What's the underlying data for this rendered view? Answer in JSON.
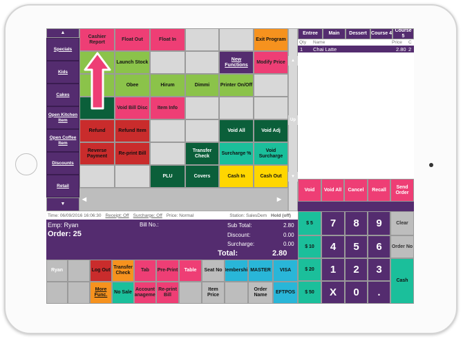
{
  "sidebar": {
    "items": [
      "Specials",
      "Kids",
      "Cakes",
      "Open Kitchen Item",
      "Open Coffee Item",
      "Discounts",
      "Retail"
    ],
    "up_arrow": "▲",
    "down_arrow": "▼"
  },
  "grid": {
    "row1": [
      "Cashier Report",
      "Float Out",
      "Float In",
      "",
      "",
      "Exit Program"
    ],
    "row2": [
      "Launch Stock",
      "",
      "",
      "New Functions",
      "Modify Price"
    ],
    "row3": [
      "Obee",
      "Hirum",
      "Dimmi",
      "Printer On/Off"
    ],
    "row4": [
      "Void Bill Disc",
      "Item Info",
      "",
      "",
      ""
    ],
    "row5": [
      "Refund",
      "Refund Item",
      "",
      "",
      "Void All",
      "Void Adj"
    ],
    "row6": [
      "Reverse Payment",
      "Re-print Bill",
      "",
      "Transfer Check",
      "Surcharge %",
      "Void Surcharge"
    ],
    "row7": [
      "",
      "",
      "PLU",
      "Covers",
      "Cash In",
      "Cash Out"
    ],
    "nav": {
      "left": "◀",
      "right": "▶",
      "up": "▲",
      "up_label": "Up",
      "down": "▼"
    }
  },
  "order_panel": {
    "courses": [
      "Entree",
      "Main",
      "Dessert",
      "Course 4",
      "Course 5"
    ],
    "headers": {
      "qty": "Qty",
      "name": "Name",
      "price": "Price",
      "c": "C"
    },
    "items": [
      {
        "qty": "1",
        "name": "Chai Latte",
        "price": "2.80",
        "c": "2"
      }
    ],
    "actions": [
      "Void",
      "Void All",
      "Cancel",
      "Recall",
      "Send Order"
    ]
  },
  "status_bar": {
    "time": "Time: 06/09/2016 16:06:30",
    "receipt": "Receipt: Off",
    "surcharge": "Surcharge: Off",
    "price": "Price: Normal",
    "station": "Station: SalesDem",
    "hold": "Hold (off)"
  },
  "summary": {
    "emp": "Emp: Ryan",
    "bill_no": "Bill No.:",
    "order": "Order: 25",
    "subtotal_label": "Sub Total:",
    "subtotal": "2.80",
    "discount_label": "Discount:",
    "discount": "0.00",
    "surcharge_label": "Surcharge:",
    "surcharge": "0.00",
    "total_label": "Total:",
    "total": "2.80"
  },
  "keypad": {
    "quick": [
      "$ 5",
      "$ 10",
      "$ 20",
      "$ 50"
    ],
    "keys": [
      "7",
      "8",
      "9",
      "4",
      "5",
      "6",
      "1",
      "2",
      "3",
      "X",
      "0",
      "."
    ],
    "clear": "Clear",
    "order_no": "Order No",
    "cash": "Cash"
  },
  "bottom_bar": {
    "row1": [
      "Ryan",
      "",
      "Log Out",
      "Transfer Check",
      "Tab",
      "Pre-Print",
      "Table",
      "Seat No",
      "Membership",
      "MASTER",
      "VISA"
    ],
    "row2": [
      "",
      "",
      "More Func.",
      "No Sale",
      "Account Management",
      "Re-print Bill",
      "",
      "Item Price",
      "",
      "Order Name",
      "EFTPOS"
    ]
  }
}
